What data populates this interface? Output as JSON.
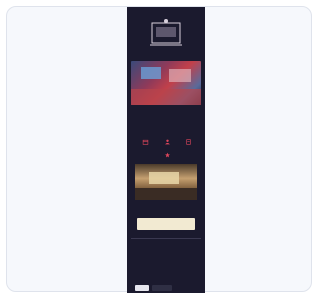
{
  "theme": {
    "card_bg": "#f6f8fc",
    "strip_bg": "#1b1a2e",
    "accent": "#e0465c",
    "cta_bg": "#f2ead2"
  },
  "email": {
    "hero_caption": "",
    "headline": "",
    "body": "",
    "icons": [
      {
        "name": "calendar-icon",
        "label": ""
      },
      {
        "name": "people-icon",
        "label": ""
      },
      {
        "name": "document-icon",
        "label": ""
      },
      {
        "name": "star-icon",
        "label": ""
      }
    ],
    "section_caption": "",
    "cta_text": "",
    "footer_left_heading": "",
    "footer_left_text": "",
    "footer_right_heading": "",
    "footer_right_text": "",
    "social_line": "",
    "badge_left": "",
    "badge_right": ""
  }
}
